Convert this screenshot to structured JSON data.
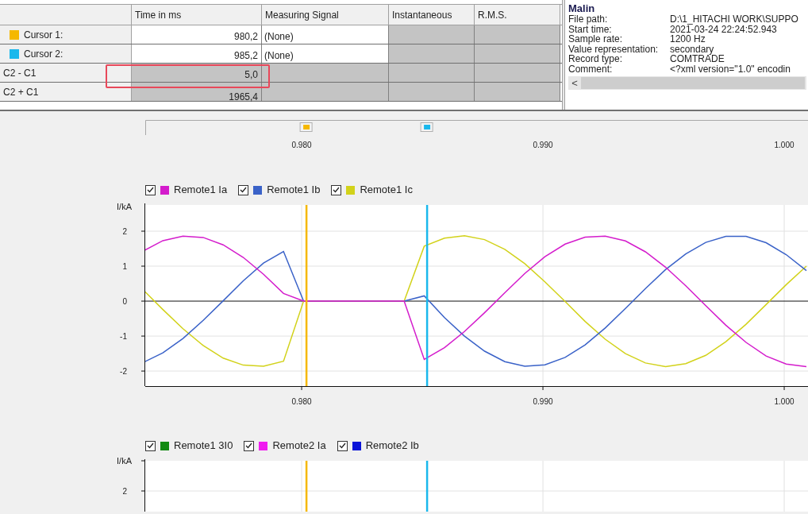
{
  "table": {
    "columns": [
      "Time in ms",
      "Measuring Signal",
      "Instantaneous",
      "R.M.S."
    ],
    "rows": [
      {
        "kind": "cursor",
        "label": "Cursor 1:",
        "color": "#f5b800",
        "time": "980,2",
        "signal": "(None)",
        "highlighted": false
      },
      {
        "kind": "cursor",
        "label": "Cursor 2:",
        "color": "#1ab8ec",
        "time": "985,2",
        "signal": "(None)",
        "highlighted": false
      },
      {
        "kind": "computed",
        "label": "C2 - C1",
        "time": "5,0",
        "highlighted": true
      },
      {
        "kind": "computed",
        "label": "C2 + C1",
        "time": "1965,4",
        "highlighted": false
      }
    ]
  },
  "info": {
    "title": "Malin",
    "fields": [
      {
        "label": "File path:",
        "value": "D:\\1_HITACHI WORK\\SUPPO"
      },
      {
        "label": "Start time:",
        "value": "2021-03-24 22:24:52.943"
      },
      {
        "label": "Sample rate:",
        "value": "1200 Hz"
      },
      {
        "label": "Value representation:",
        "value": "secondary"
      },
      {
        "label": "Record type:",
        "value": "COMTRADE"
      },
      {
        "label": "Comment:",
        "value": "<?xml version=\"1.0\" encodin"
      }
    ],
    "scroll_left": "<"
  },
  "ruler": {
    "ticks": [
      "0.980",
      "0.990",
      "1.000"
    ]
  },
  "charts": [
    {
      "legend": [
        {
          "checked": true
        },
        {
          "checked": true
        },
        {
          "checked": true
        }
      ],
      "chart_data": {
        "type": "line",
        "ylabel": "I/kA",
        "xlim": [
          0.97342,
          1.00092
        ],
        "ylim": [
          -2.43,
          2.75
        ],
        "grid": true,
        "xticks": [
          {
            "value": 0.98,
            "label": "0.980"
          },
          {
            "value": 0.99,
            "label": "0.990"
          },
          {
            "value": 1.0,
            "label": "1.000"
          }
        ],
        "yticks": [
          -2,
          -1,
          0,
          1,
          2
        ],
        "x": [
          0.97342,
          0.97425,
          0.97508,
          0.97592,
          0.97675,
          0.97758,
          0.97842,
          0.97925,
          0.98008,
          0.98092,
          0.98175,
          0.98258,
          0.98342,
          0.98425,
          0.98508,
          0.98592,
          0.98675,
          0.98758,
          0.98842,
          0.98925,
          0.99008,
          0.99092,
          0.99175,
          0.99258,
          0.99342,
          0.99425,
          0.99508,
          0.99592,
          0.99675,
          0.99758,
          0.99842,
          0.99925,
          1.00008,
          1.00092
        ],
        "series": [
          {
            "name": "Remote1 Ia",
            "color": "#d41ccc",
            "values": [
              1.43,
              1.73,
              1.86,
              1.82,
              1.61,
              1.25,
              0.77,
              0.22,
              0,
              0,
              0,
              0,
              0,
              0,
              -1.67,
              -1.33,
              -0.87,
              -0.33,
              0.24,
              0.79,
              1.27,
              1.63,
              1.83,
              1.86,
              1.72,
              1.41,
              0.97,
              0.44,
              -0.13,
              -0.69,
              -1.18,
              -1.57,
              -1.8,
              -1.87
            ]
          },
          {
            "name": "Remote1 Ib",
            "color": "#3a62c8",
            "values": [
              -1.76,
              -1.48,
              -1.07,
              -0.55,
              0.01,
              0.58,
              1.09,
              1.42,
              0,
              null,
              null,
              null,
              null,
              0,
              0.15,
              -0.47,
              -1.0,
              -1.43,
              -1.73,
              -1.86,
              -1.82,
              -1.61,
              -1.25,
              -0.77,
              -0.21,
              0.36,
              0.9,
              1.35,
              1.68,
              1.85,
              1.85,
              1.67,
              1.33,
              0.87
            ]
          },
          {
            "name": "Remote1 Ic",
            "color": "#d2d21a",
            "values": [
              0.33,
              -0.24,
              -0.79,
              -1.27,
              -1.63,
              -1.83,
              -1.86,
              -1.72,
              0,
              null,
              null,
              null,
              null,
              0,
              1.57,
              1.8,
              1.87,
              1.76,
              1.48,
              1.07,
              0.55,
              -0.01,
              -0.58,
              -1.09,
              -1.5,
              -1.77,
              -1.87,
              -1.79,
              -1.55,
              -1.16,
              -0.66,
              -0.1,
              0.47,
              1.0
            ]
          }
        ],
        "ref_lines": [
          {
            "axis": "x",
            "value": 0.9802,
            "color": "#f5b800"
          },
          {
            "axis": "x",
            "value": 0.9852,
            "color": "#1ab8ec"
          }
        ]
      }
    },
    {
      "legend": [
        {
          "label": "Remote1 3I0",
          "color": "#128a12",
          "checked": true
        },
        {
          "label": "Remote2 Ia",
          "color": "#f01cf0",
          "checked": true
        },
        {
          "label": "Remote2 Ib",
          "color": "#0a14d8",
          "checked": true
        }
      ],
      "ylabel": "I/kA",
      "ytick_labels": [
        "2"
      ]
    }
  ]
}
